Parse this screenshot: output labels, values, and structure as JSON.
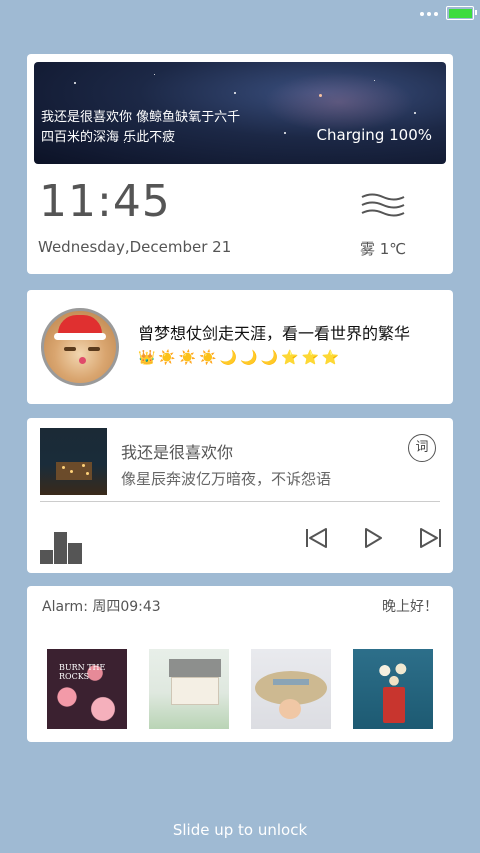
{
  "status": {
    "battery_color": "#3ddc3d"
  },
  "widget_time": {
    "quote_line1": "我还是很喜欢你 像鲸鱼缺氧于六千",
    "quote_line2": "四百米的深海 乐此不疲",
    "charging": "Charging 100%",
    "time": "11:45",
    "date": "Wednesday,December 21",
    "weather": "雾 1℃",
    "weather_icon": "fog-icon"
  },
  "profile": {
    "motto": "曾梦想仗剑走天涯，看一看世界的繁华",
    "badges": "👑☀️☀️☀️🌙🌙🌙⭐⭐⭐"
  },
  "music": {
    "title": "我还是很喜欢你",
    "lyric": "像星辰奔波亿万暗夜，不诉怨语",
    "lyric_button": "词"
  },
  "alarm_card": {
    "alarm": "Alarm: 周四09:43",
    "greeting": "晚上好！",
    "thumb1_text1": "BURN THE",
    "thumb1_text2": "ROCKS"
  },
  "unlock": "Slide up to unlock"
}
